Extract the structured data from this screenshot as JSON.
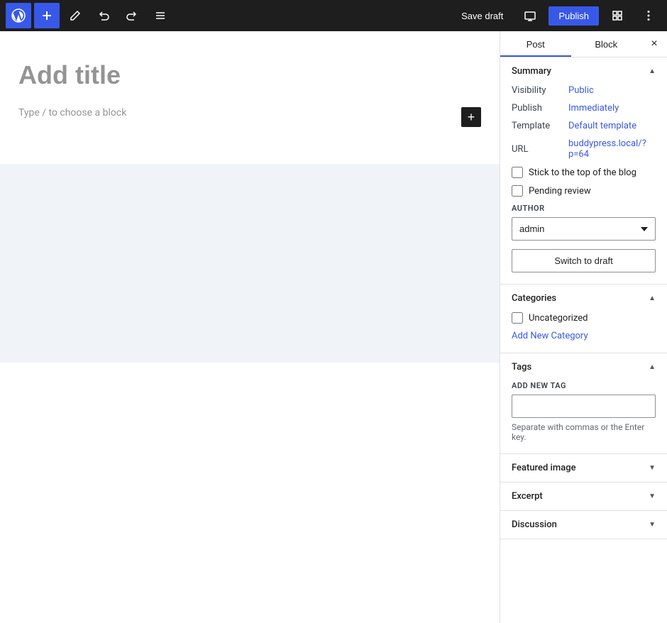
{
  "toolbar": {
    "wp_logo_label": "WordPress",
    "add_label": "+",
    "edit_label": "✎",
    "undo_label": "↩",
    "redo_label": "↪",
    "list_view_label": "≡",
    "save_draft_label": "Save draft",
    "publish_label": "Publish",
    "preview_label": "Preview",
    "settings_label": "Settings",
    "tools_label": "Tools",
    "more_label": "⋯"
  },
  "editor": {
    "title_placeholder": "Add title",
    "block_placeholder": "Type / to choose a block"
  },
  "sidebar": {
    "post_tab_label": "Post",
    "block_tab_label": "Block",
    "close_label": "×",
    "summary": {
      "heading": "Summary",
      "visibility_label": "Visibility",
      "visibility_value": "Public",
      "publish_label": "Publish",
      "publish_value": "Immediately",
      "template_label": "Template",
      "template_value": "Default template",
      "url_label": "URL",
      "url_value": "buddypress.local/?p=64",
      "stick_to_top_label": "Stick to the top of the blog",
      "pending_review_label": "Pending review",
      "author_field_label": "AUTHOR",
      "author_value": "admin",
      "switch_draft_label": "Switch to draft"
    },
    "categories": {
      "heading": "Categories",
      "uncategorized_label": "Uncategorized",
      "add_new_label": "Add New Category"
    },
    "tags": {
      "heading": "Tags",
      "add_new_label": "ADD NEW TAG",
      "input_placeholder": "",
      "hint": "Separate with commas or the Enter key."
    },
    "featured_image": {
      "heading": "Featured image"
    },
    "excerpt": {
      "heading": "Excerpt"
    },
    "discussion": {
      "heading": "Discussion"
    }
  }
}
